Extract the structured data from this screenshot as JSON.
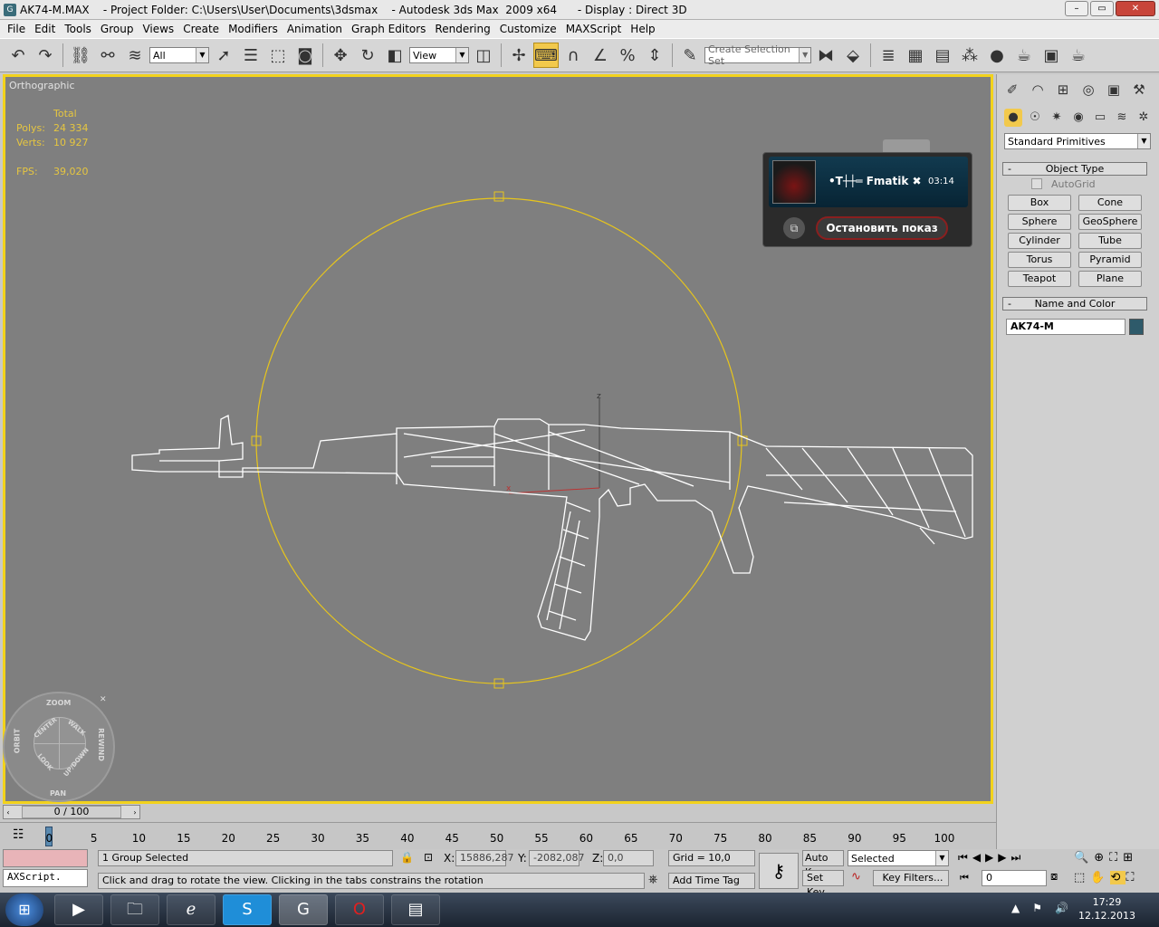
{
  "window": {
    "title": "AK74-M.MAX    - Project Folder: C:\\Users\\User\\Documents\\3dsmax    - Autodesk 3ds Max  2009 x64      - Display : Direct 3D",
    "minimize": "–",
    "restore": "▭",
    "close": "✕"
  },
  "menu": [
    "File",
    "Edit",
    "Tools",
    "Group",
    "Views",
    "Create",
    "Modifiers",
    "Animation",
    "Graph Editors",
    "Rendering",
    "Customize",
    "MAXScript",
    "Help"
  ],
  "toolbar": {
    "filter_value": "All",
    "refcoord_value": "View",
    "selection_set_placeholder": "Create Selection Set"
  },
  "viewport": {
    "label": "Orthographic",
    "stats_header": "Total",
    "polys_label": "Polys:",
    "polys_value": "24 334",
    "verts_label": "Verts:",
    "verts_value": "10 927",
    "fps_label": "FPS:",
    "fps_value": "39,020",
    "axis_x": "x",
    "axis_z": "z"
  },
  "stream_popup": {
    "user": "•Т┼┼═ Fmatik ✖",
    "time": "03:14",
    "stop_button": "Остановить показ"
  },
  "steering_wheel": {
    "zoom": "ZOOM",
    "orbit": "ORBIT",
    "rewind": "REWIND",
    "pan": "PAN",
    "center": "CENTER",
    "walk": "WALK",
    "look": "LOOK",
    "updown": "UP/DOWN"
  },
  "time_slider": {
    "label": "0 / 100"
  },
  "trackbar_ticks": [
    "0",
    "5",
    "10",
    "15",
    "20",
    "25",
    "30",
    "35",
    "40",
    "45",
    "50",
    "55",
    "60",
    "65",
    "70",
    "75",
    "80",
    "85",
    "90",
    "95",
    "100"
  ],
  "command_panel": {
    "category": "Standard Primitives",
    "object_type_title": "Object Type",
    "autogrid": "AutoGrid",
    "buttons": [
      "Box",
      "Cone",
      "Sphere",
      "GeoSphere",
      "Cylinder",
      "Tube",
      "Torus",
      "Pyramid",
      "Teapot",
      "Plane"
    ],
    "name_color_title": "Name and Color",
    "object_name": "AK74-M",
    "object_color": "#2e5a6a",
    "rollout_collapse": "-"
  },
  "status": {
    "maxscript": "AXScript.",
    "selection": "1 Group Selected",
    "prompt": "Click and drag to rotate the view.  Clicking in the tabs constrains the rotation",
    "x_label": "X:",
    "x_value": "15886,287",
    "y_label": "Y:",
    "y_value": "-2082,087",
    "z_label": "Z:",
    "z_value": "0,0",
    "grid": "Grid = 10,0",
    "add_time_tag": "Add Time Tag",
    "auto_key": "Auto Key",
    "set_key": "Set Key",
    "key_mode": "Selected",
    "key_filters": "Key Filters...",
    "frame": "0"
  },
  "taskbar": {
    "time": "17:29",
    "date": "12.12.2013"
  }
}
